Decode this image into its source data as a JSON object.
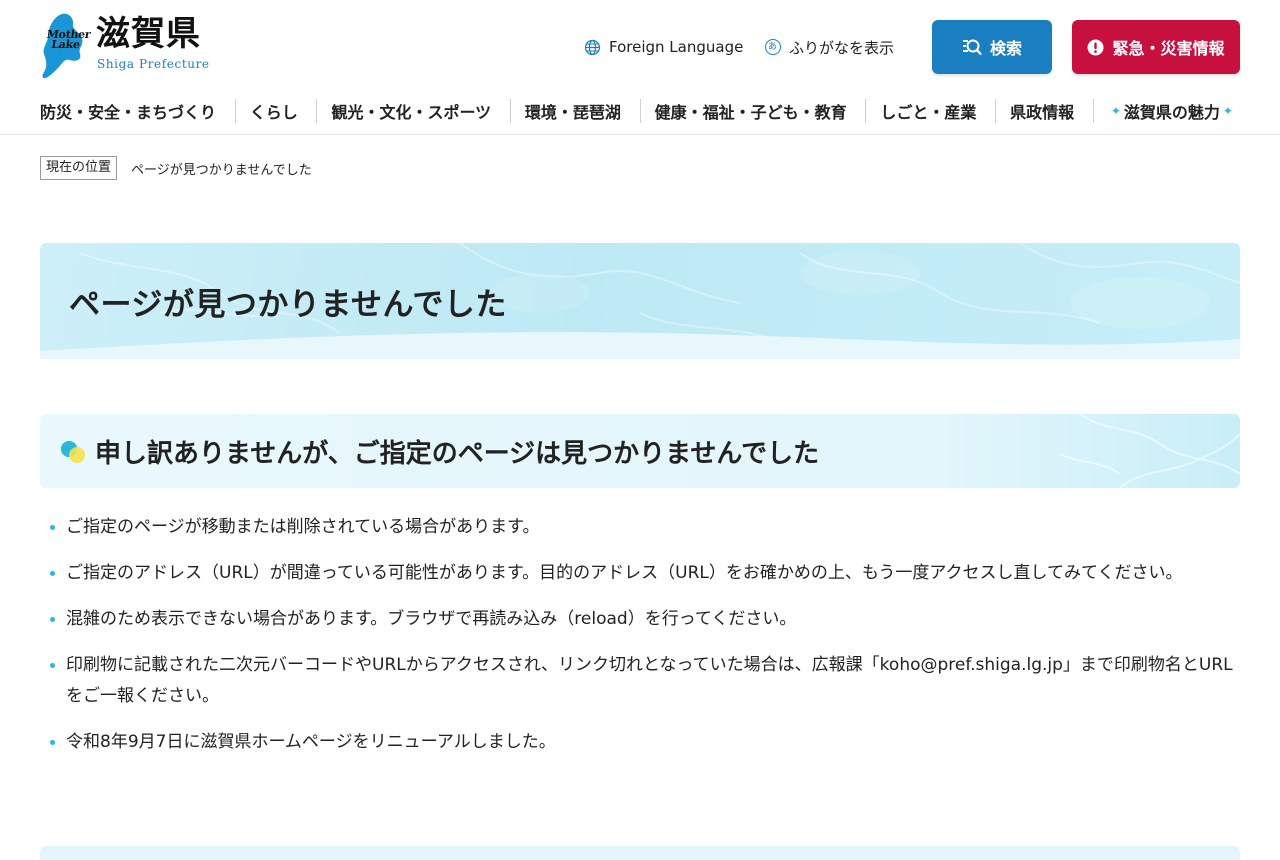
{
  "header": {
    "logo": {
      "mark_line1": "Mother",
      "mark_line2": "Lake",
      "title": "滋賀県",
      "subtitle": "Shiga Prefecture"
    },
    "utility": {
      "foreign_language": "Foreign Language",
      "furigana": "ふりがなを表示",
      "furigana_icon_char": "あ"
    },
    "buttons": {
      "search": "検索",
      "emergency": "緊急・災害情報"
    },
    "nav": [
      "防災・安全・まちづくり",
      "くらし",
      "観光・文化・スポーツ",
      "環境・琵琶湖",
      "健康・福祉・子ども・教育",
      "しごと・産業",
      "県政情報",
      "滋賀県の魅力"
    ]
  },
  "breadcrumb": {
    "label": "現在の位置",
    "current": "ページが見つかりませんでした"
  },
  "main": {
    "page_title": "ページが見つかりませんでした",
    "section_title": "申し訳ありませんが、ご指定のページは見つかりませんでした",
    "notes": [
      "ご指定のページが移動または削除されている場合があります。",
      "ご指定のアドレス（URL）が間違っている可能性があります。目的のアドレス（URL）をお確かめの上、もう一度アクセスし直してみてください。",
      "混雑のため表示できない場合があります。ブラウザで再読み込み（reload）を行ってください。",
      "印刷物に記載された二次元バーコードやURLからアクセスされ、リンク切れとなっていた場合は、広報課「koho@pref.shiga.lg.jp」まで印刷物名とURLをご一報ください。",
      "令和8年9月7日に滋賀県ホームページをリニューアルしました。"
    ]
  },
  "colors": {
    "brand_blue": "#1a7fc1",
    "emergency_red": "#c8103f",
    "accent_cyan": "#29b7dc",
    "banner_bg": "#c7eef8"
  },
  "icons": {
    "globe": "globe-icon",
    "furigana": "furigana-icon",
    "search": "search-icon",
    "emergency": "exclamation-icon",
    "sparkle": "sparkle-icon"
  }
}
